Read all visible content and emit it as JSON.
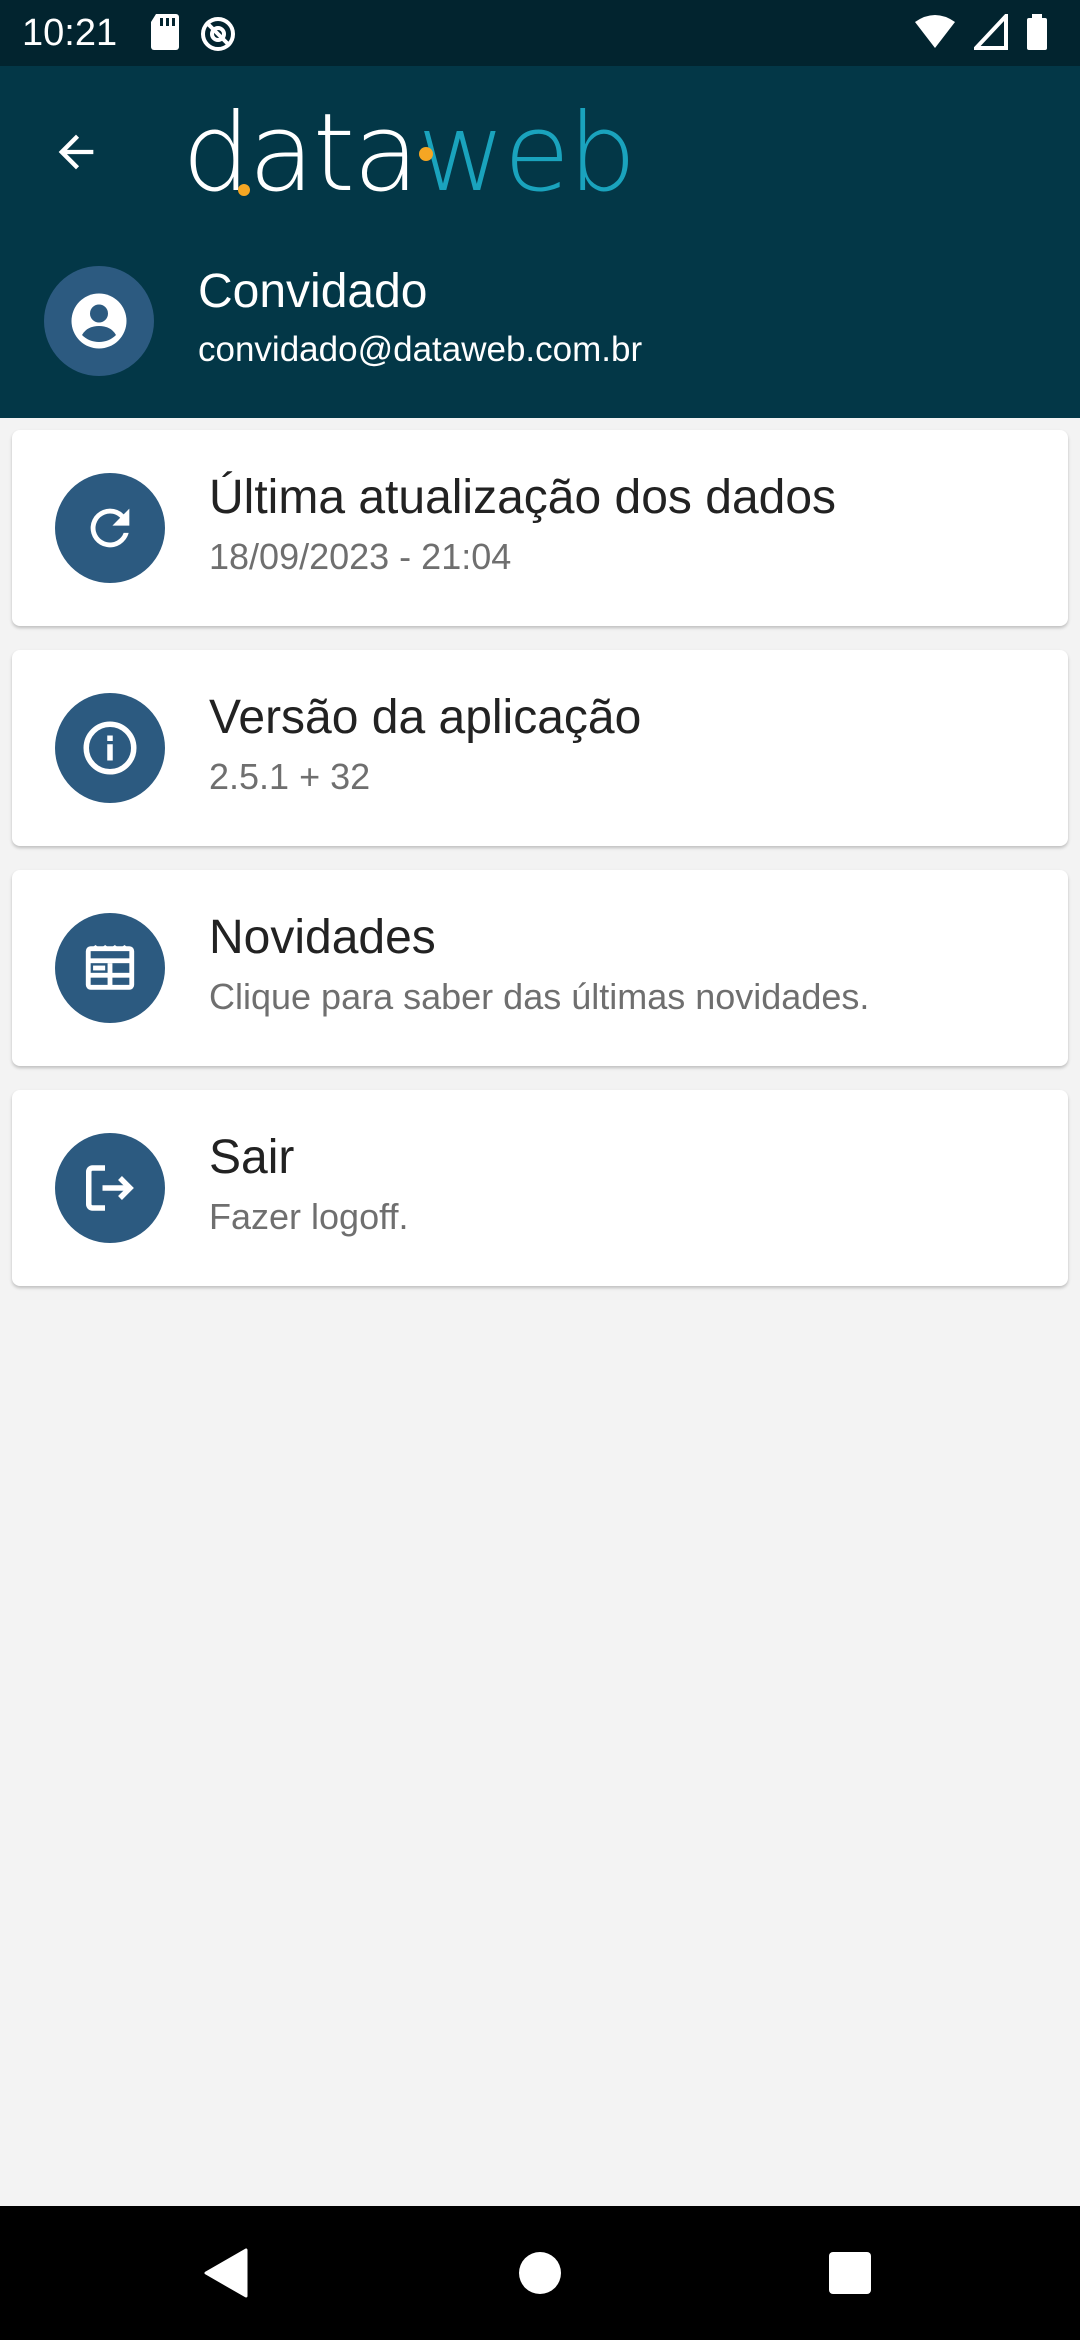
{
  "status_bar": {
    "time": "10:21",
    "left_icons": [
      "sd-card-icon",
      "no-sync-icon"
    ],
    "right_icons": [
      "wifi-icon",
      "signal-icon",
      "battery-icon"
    ]
  },
  "header": {
    "logo_part1": "data",
    "logo_part2": "web",
    "logo_colors": {
      "part1": "#ffffff",
      "part2": "#1aa3bd",
      "accent_dot": "#f5a623"
    },
    "background": "#033747",
    "back_icon": "arrow-left-icon"
  },
  "user": {
    "name": "Convidado",
    "email": "convidado@dataweb.com.br",
    "avatar_icon": "account-circle-icon"
  },
  "menu": {
    "items": [
      {
        "title": "Última atualização dos dados",
        "subtitle": "18/09/2023 - 21:04",
        "icon": "refresh-icon"
      },
      {
        "title": "Versão da aplicação",
        "subtitle": "2.5.1 + 32",
        "icon": "info-icon"
      },
      {
        "title": "Novidades",
        "subtitle": "Clique para saber das últimas novidades.",
        "icon": "news-icon"
      },
      {
        "title": "Sair",
        "subtitle": "Fazer logoff.",
        "icon": "logout-icon"
      }
    ],
    "icon_background": "#2c5a80"
  },
  "nav_bar": {
    "buttons": [
      "back-triangle-icon",
      "home-circle-icon",
      "recents-square-icon"
    ]
  }
}
